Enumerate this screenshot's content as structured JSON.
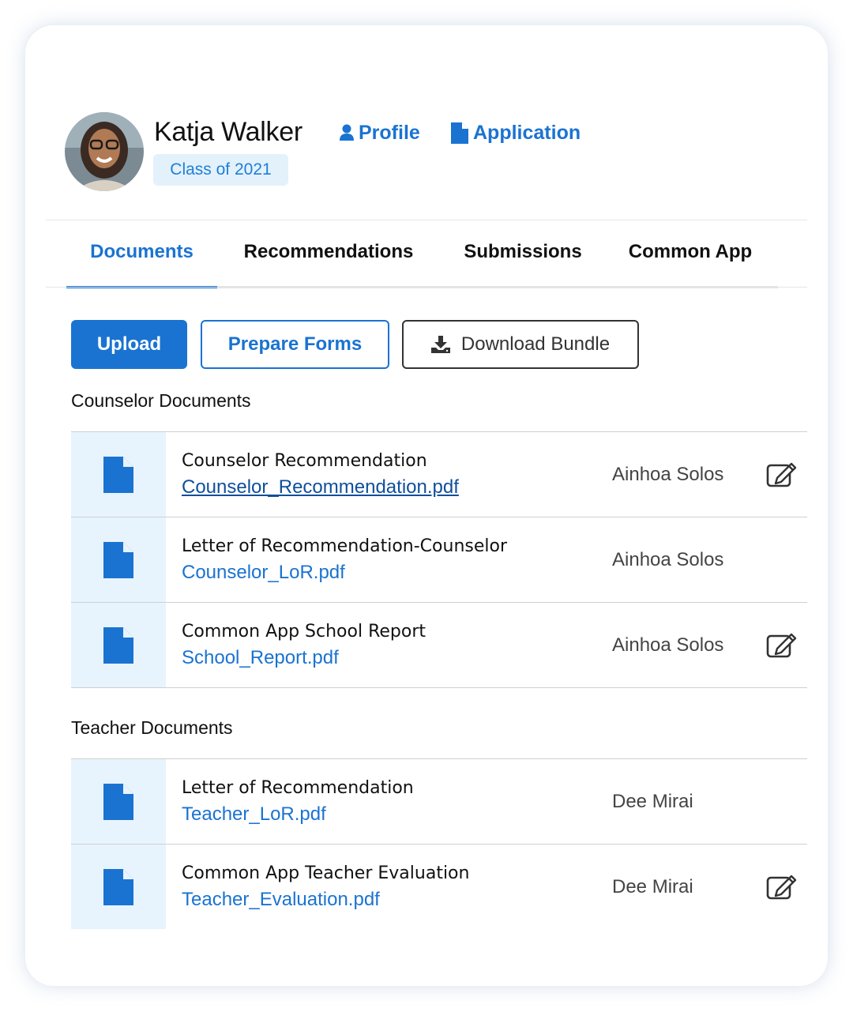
{
  "header": {
    "student_name": "Katja Walker",
    "class_badge": "Class of 2021",
    "profile_link": "Profile",
    "application_link": "Application"
  },
  "tabs": [
    {
      "label": "Documents",
      "active": true
    },
    {
      "label": "Recommendations",
      "active": false
    },
    {
      "label": "Submissions",
      "active": false
    },
    {
      "label": "Common App",
      "active": false
    }
  ],
  "toolbar": {
    "upload_label": "Upload",
    "prepare_label": "Prepare Forms",
    "download_label": "Download Bundle"
  },
  "sections": {
    "counselor": {
      "title": "Counselor Documents",
      "rows": [
        {
          "title": "Counselor Recommendation",
          "file": "Counselor_Recommendation.pdf",
          "owner": "Ainhoa Solos",
          "editable": true
        },
        {
          "title": "Letter of Recommendation-Counselor",
          "file": "Counselor_LoR.pdf",
          "owner": "Ainhoa Solos",
          "editable": false
        },
        {
          "title": "Common App School Report",
          "file": "School_Report.pdf",
          "owner": "Ainhoa Solos",
          "editable": true
        }
      ]
    },
    "teacher": {
      "title": "Teacher Documents",
      "rows": [
        {
          "title": "Letter of Recommendation",
          "file": "Teacher_LoR.pdf",
          "owner": "Dee Mirai",
          "editable": false
        },
        {
          "title": "Common App Teacher Evaluation",
          "file": "Teacher_Evaluation.pdf",
          "owner": "Dee Mirai",
          "editable": true
        }
      ]
    }
  },
  "colors": {
    "accent": "#1a73d1",
    "file_cell_bg": "#e8f4fd",
    "badge_bg": "#e3f1fb"
  },
  "icons": [
    "user-icon",
    "document-icon",
    "download-icon",
    "file-icon",
    "edit-icon"
  ]
}
